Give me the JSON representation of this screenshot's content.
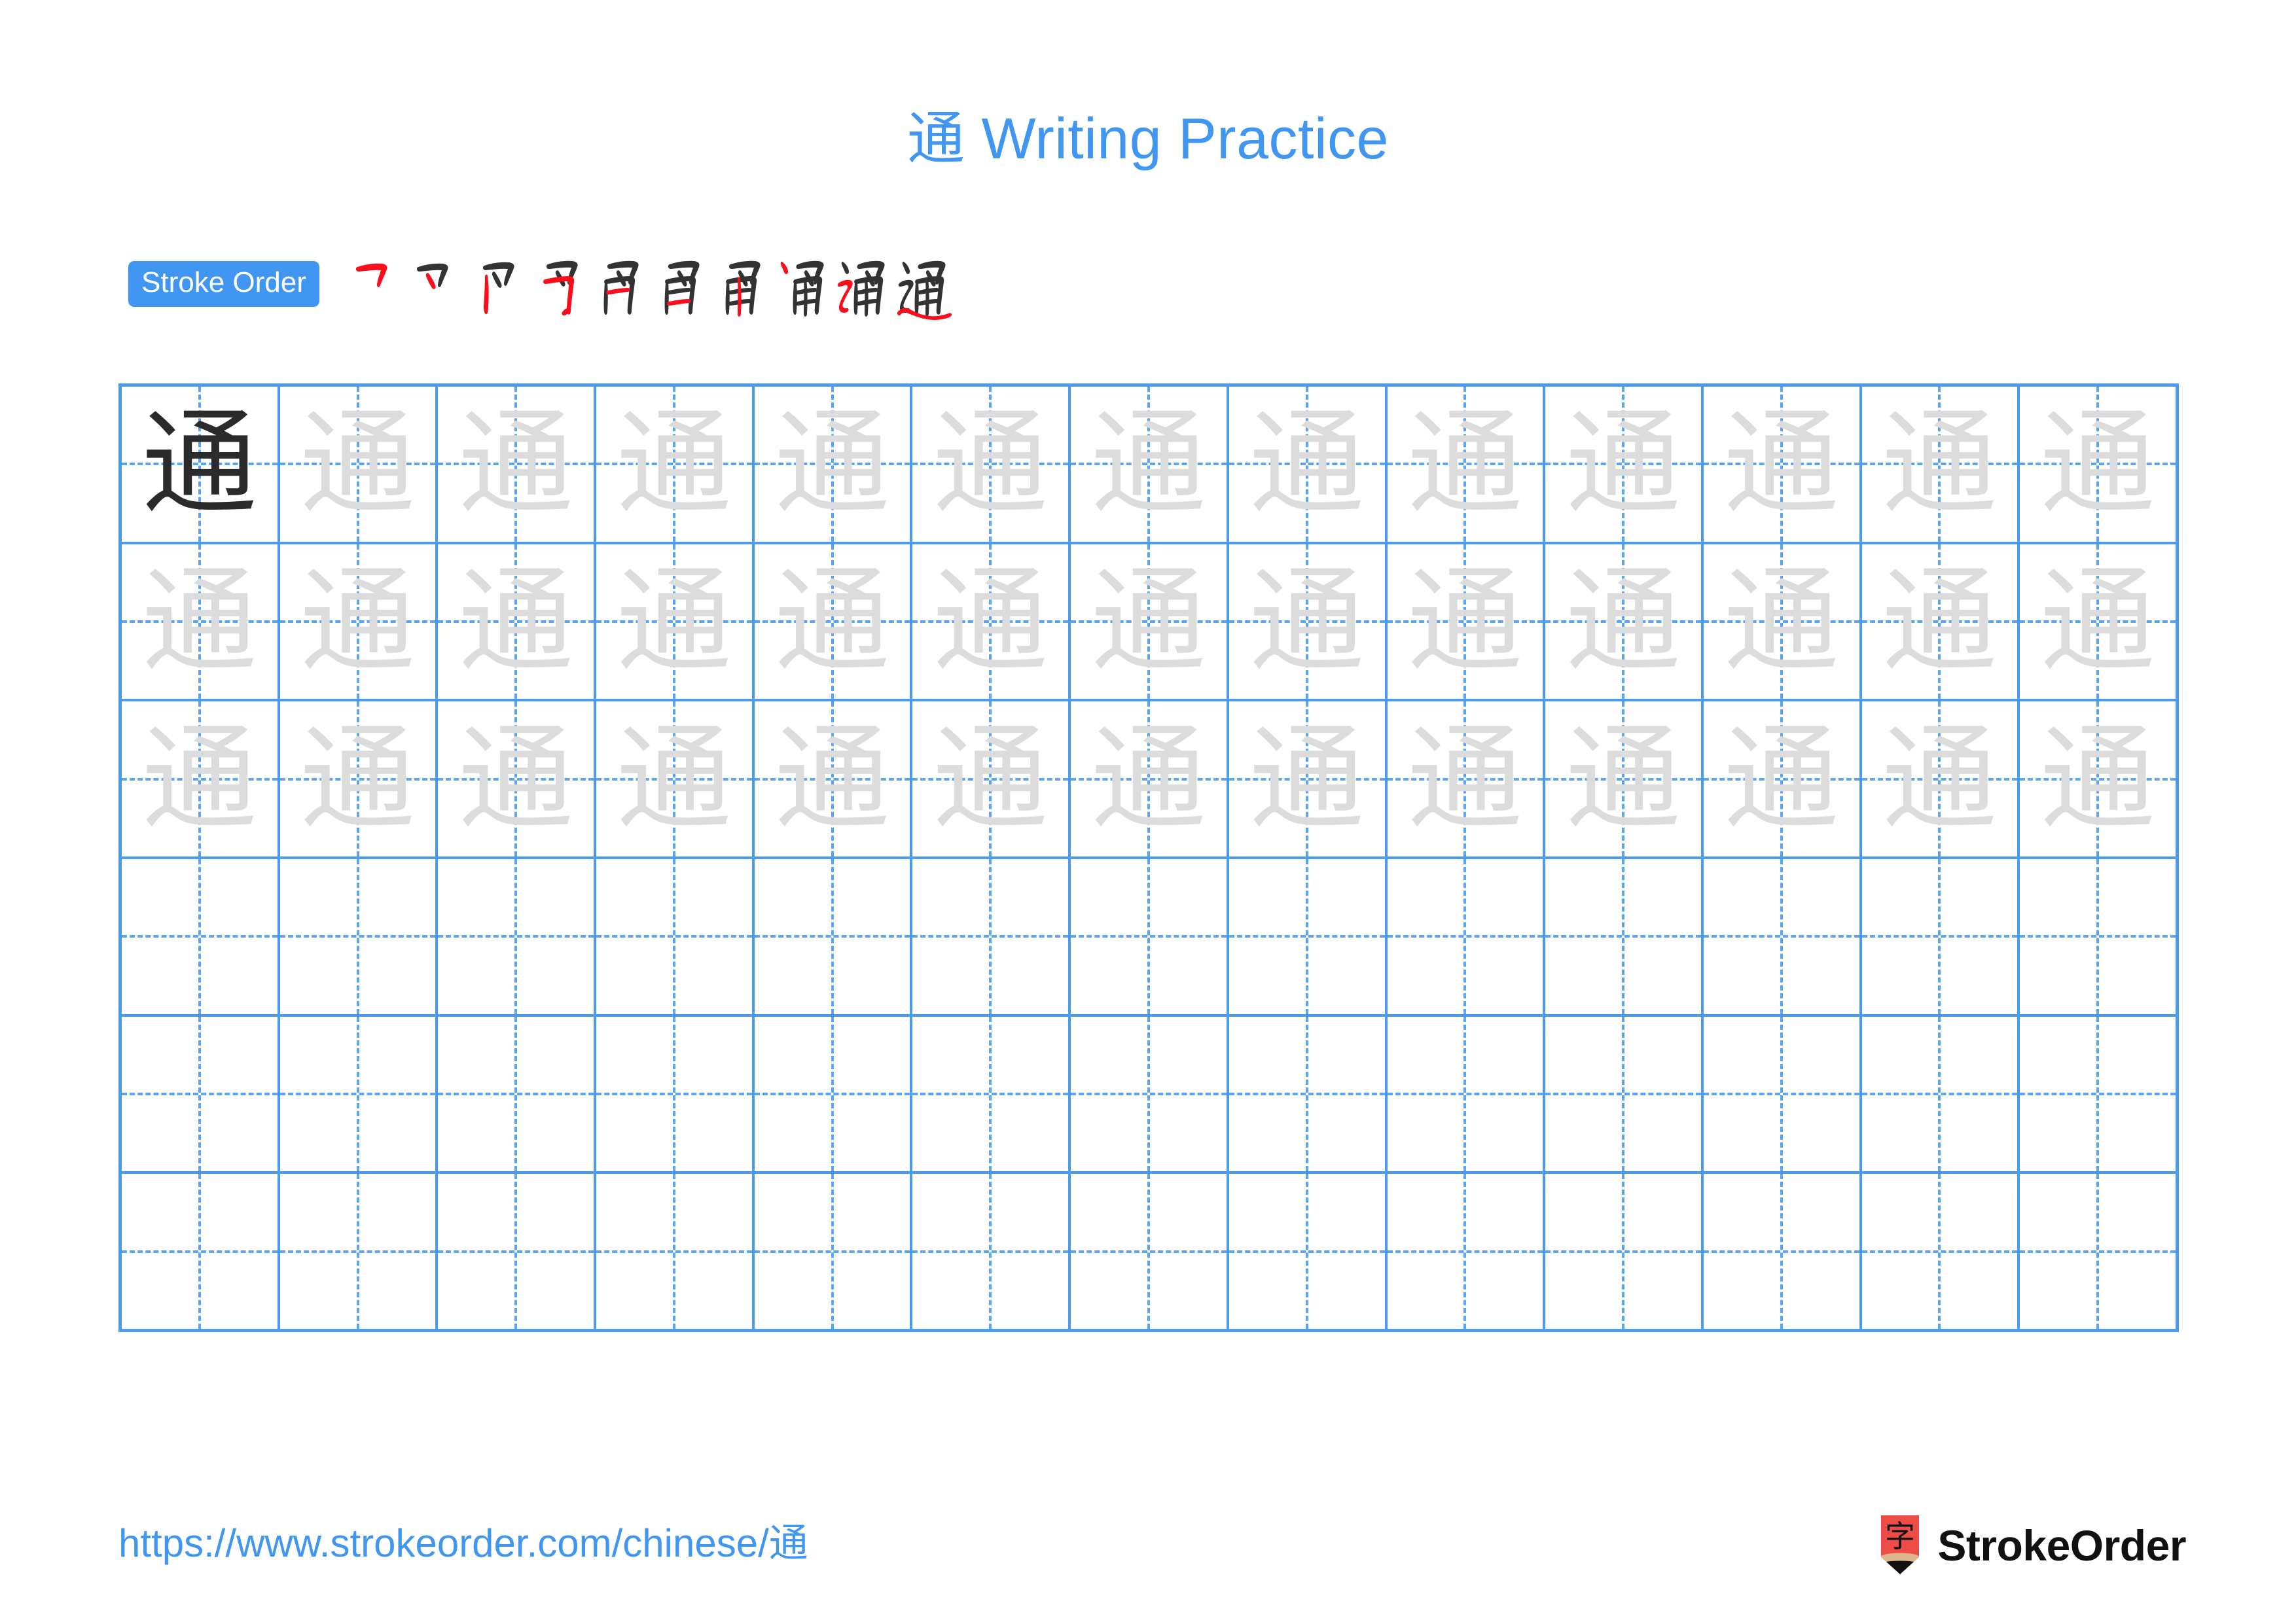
{
  "page": {
    "character": "通",
    "title": "通 Writing Practice",
    "title_character": "通",
    "title_text": " Writing Practice",
    "accent_color": "#4096F0",
    "grid_line_color": "#4A9BF0",
    "trace_color": "#DCDCDC",
    "dark_char_color": "#2B2B2B",
    "stroke_done_color": "#333333",
    "stroke_new_color": "#FC0D1B"
  },
  "stroke_order": {
    "badge_label": "Stroke Order",
    "total_strokes": 10,
    "steps": [
      {
        "index": 1,
        "name": "stroke-step-1",
        "partial": "乛"
      },
      {
        "index": 2,
        "name": "stroke-step-2",
        "partial": "マ"
      },
      {
        "index": 3,
        "name": "stroke-step-3",
        "partial": "⺈丿"
      },
      {
        "index": 4,
        "name": "stroke-step-4",
        "partial": "⺙"
      },
      {
        "index": 5,
        "name": "stroke-step-5",
        "partial": "甪"
      },
      {
        "index": 6,
        "name": "stroke-step-6",
        "partial": "甪"
      },
      {
        "index": 7,
        "name": "stroke-step-7",
        "partial": "甬"
      },
      {
        "index": 8,
        "name": "stroke-step-8",
        "partial": "丶甬"
      },
      {
        "index": 9,
        "name": "stroke-step-9",
        "partial": "⻌甬"
      },
      {
        "index": 10,
        "name": "stroke-step-10",
        "partial": "通"
      }
    ]
  },
  "practice_grid": {
    "columns": 13,
    "rows": 6,
    "cells": [
      [
        "dark",
        "trace",
        "trace",
        "trace",
        "trace",
        "trace",
        "trace",
        "trace",
        "trace",
        "trace",
        "trace",
        "trace",
        "trace"
      ],
      [
        "trace",
        "trace",
        "trace",
        "trace",
        "trace",
        "trace",
        "trace",
        "trace",
        "trace",
        "trace",
        "trace",
        "trace",
        "trace"
      ],
      [
        "trace",
        "trace",
        "trace",
        "trace",
        "trace",
        "trace",
        "trace",
        "trace",
        "trace",
        "trace",
        "trace",
        "trace",
        "trace"
      ],
      [
        "empty",
        "empty",
        "empty",
        "empty",
        "empty",
        "empty",
        "empty",
        "empty",
        "empty",
        "empty",
        "empty",
        "empty",
        "empty"
      ],
      [
        "empty",
        "empty",
        "empty",
        "empty",
        "empty",
        "empty",
        "empty",
        "empty",
        "empty",
        "empty",
        "empty",
        "empty",
        "empty"
      ],
      [
        "empty",
        "empty",
        "empty",
        "empty",
        "empty",
        "empty",
        "empty",
        "empty",
        "empty",
        "empty",
        "empty",
        "empty",
        "empty"
      ]
    ]
  },
  "footer": {
    "url": "https://www.strokeorder.com/chinese/通",
    "brand_name": "StrokeOrder",
    "logo_character": "字",
    "logo_body_color": "#EF4B47",
    "logo_wood_color": "#DCB78E",
    "logo_tip_color": "#111111"
  }
}
